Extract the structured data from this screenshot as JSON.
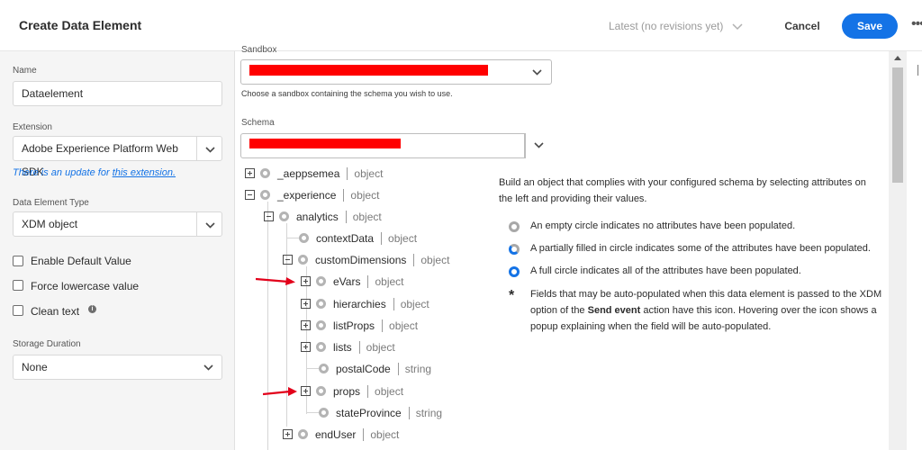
{
  "header": {
    "title": "Create Data Element",
    "revisions": "Latest (no revisions yet)",
    "cancel": "Cancel",
    "save": "Save",
    "more": "•••"
  },
  "left": {
    "name_label": "Name",
    "name_value": "Dataelement",
    "extension_label": "Extension",
    "extension_value": "Adobe Experience Platform Web SDK",
    "update_prefix": "There is an update for ",
    "update_link": "this extension.",
    "type_label": "Data Element Type",
    "type_value": "XDM object",
    "checkboxes": [
      "Enable Default Value",
      "Force lowercase value",
      "Clean text"
    ],
    "storage_label": "Storage Duration",
    "storage_value": "None"
  },
  "middle": {
    "sandbox_label": "Sandbox",
    "sandbox_help": "Choose a sandbox containing the schema you wish to use.",
    "schema_label": "Schema"
  },
  "tree": [
    {
      "name": "_aeppsemea",
      "type": "object",
      "expander": "plus"
    },
    {
      "name": "_experience",
      "type": "object",
      "expander": "minus"
    },
    {
      "name": "analytics",
      "type": "object",
      "expander": "minus"
    },
    {
      "name": "contextData",
      "type": "object",
      "expander": "none"
    },
    {
      "name": "customDimensions",
      "type": "object",
      "expander": "minus"
    },
    {
      "name": "eVars",
      "type": "object",
      "expander": "plus"
    },
    {
      "name": "hierarchies",
      "type": "object",
      "expander": "plus"
    },
    {
      "name": "listProps",
      "type": "object",
      "expander": "plus"
    },
    {
      "name": "lists",
      "type": "object",
      "expander": "plus"
    },
    {
      "name": "postalCode",
      "type": "string",
      "expander": "none"
    },
    {
      "name": "props",
      "type": "object",
      "expander": "plus"
    },
    {
      "name": "stateProvince",
      "type": "string",
      "expander": "none"
    },
    {
      "name": "endUser",
      "type": "object",
      "expander": "plus"
    }
  ],
  "info": {
    "intro": "Build an object that complies with your configured schema by selecting attributes on the left and providing their values.",
    "empty": "An empty circle indicates no attributes have been populated.",
    "partial": "A partially filled in circle indicates some of the attributes have been populated.",
    "full": "A full circle indicates all of the attributes have been populated.",
    "star_text_1": "Fields that may be auto-populated when this data element is passed to the XDM option of the ",
    "star_bold": "Send event",
    "star_text_2": " action have this icon. Hovering over the icon shows a popup explaining when the field will be auto-populated."
  },
  "colors": {
    "accent": "#1473e6",
    "redaction": "#ff0000",
    "annotation_arrow": "#e2001a"
  }
}
